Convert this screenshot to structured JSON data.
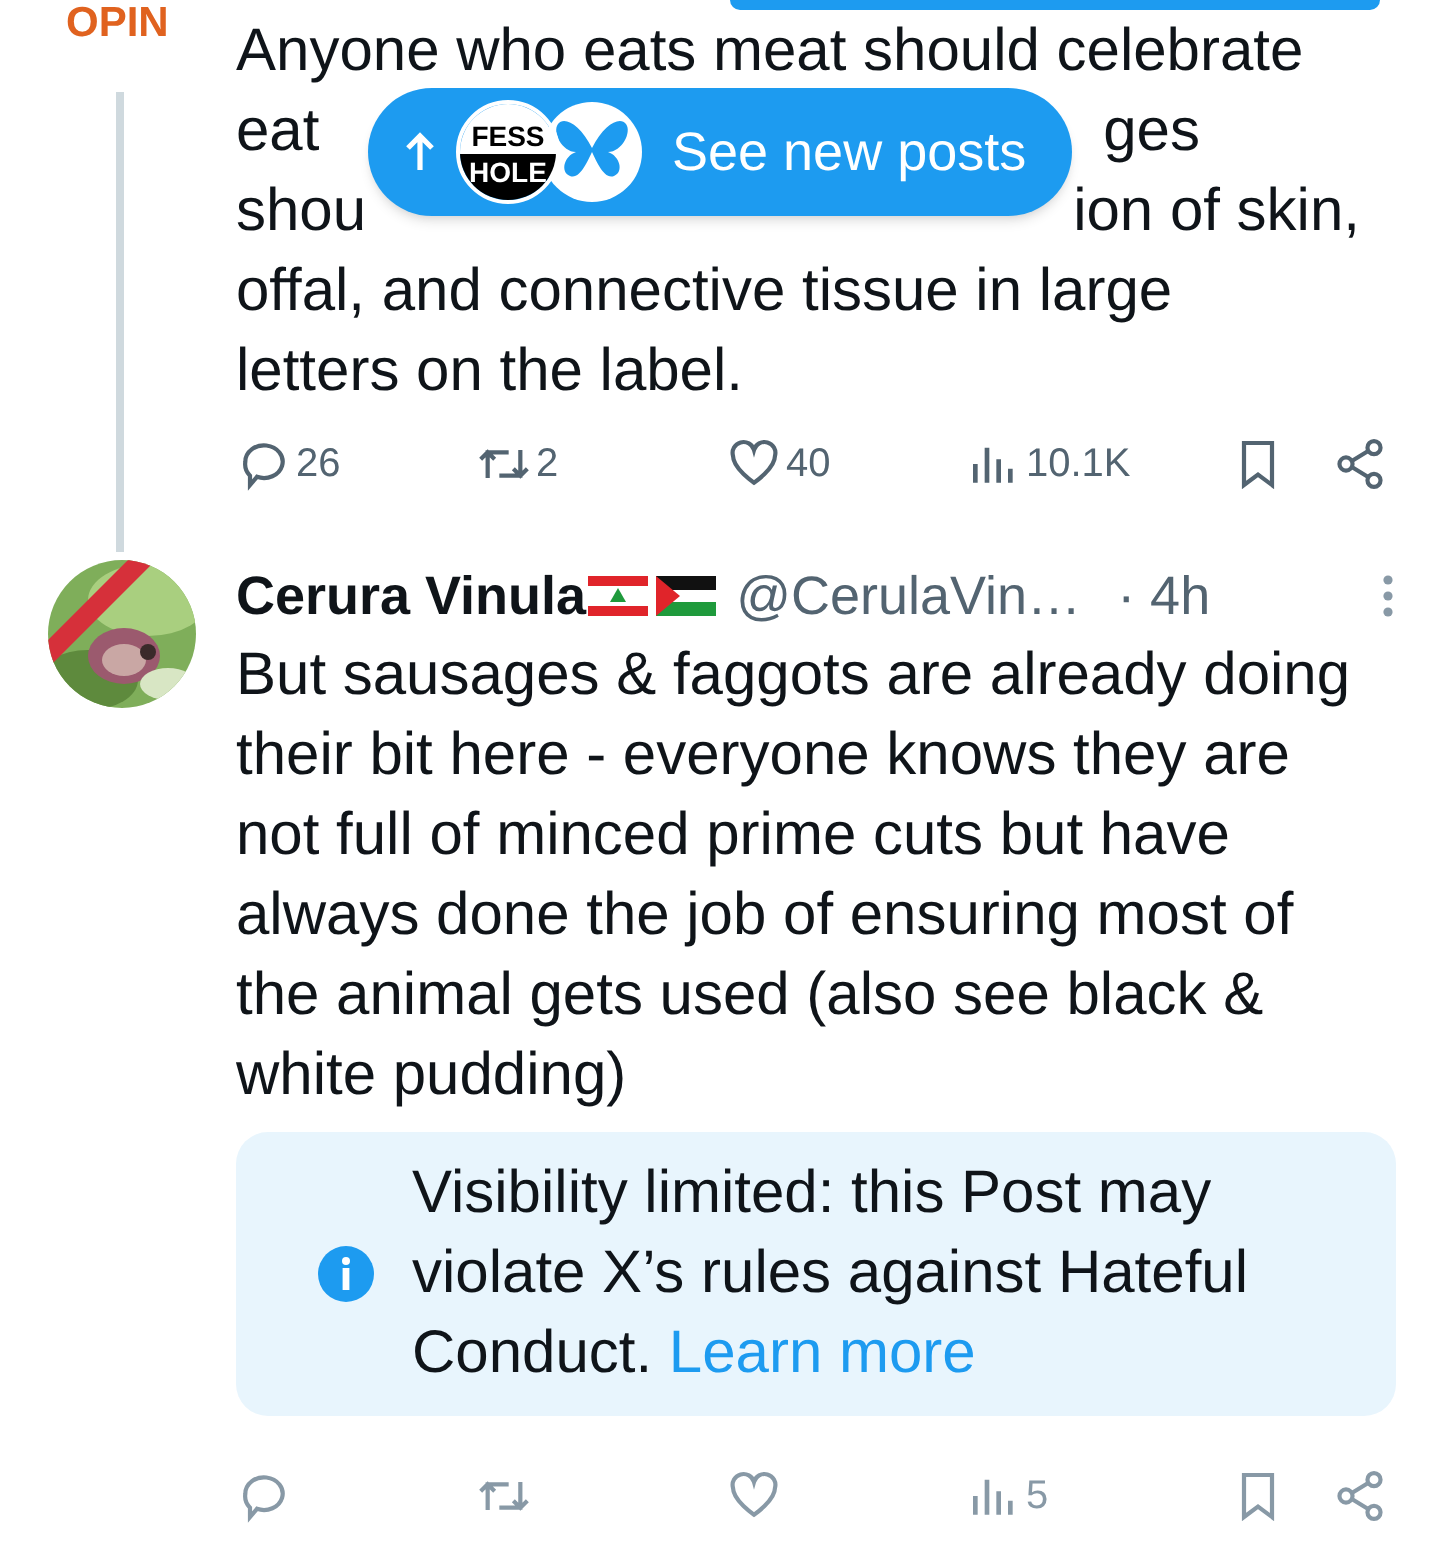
{
  "prev_post": {
    "label": "OPIN",
    "text_lines": [
      {
        "parts": [
          "Anyone who eats meat should celebrate"
        ]
      },
      {
        "parts": [
          "eat",
          "ges"
        ]
      },
      {
        "parts": [
          "shou",
          "ion of skin,"
        ]
      },
      {
        "parts": [
          "offal, and connective tissue in large"
        ]
      },
      {
        "parts": [
          "letters on the label."
        ]
      }
    ],
    "actions": [
      {
        "kind": "reply",
        "count": "26"
      },
      {
        "kind": "repost",
        "count": "2"
      },
      {
        "kind": "like",
        "count": "40"
      },
      {
        "kind": "views",
        "count": "10.1K"
      },
      {
        "kind": "bookmark"
      },
      {
        "kind": "share"
      }
    ]
  },
  "new_posts_pill": {
    "label": "See new posts",
    "avatar_text": [
      "FESS",
      "HOLE"
    ]
  },
  "post": {
    "name": "Cerura Vinula",
    "handle": "@CerulaVin…",
    "time": "· 4h",
    "text": "But sausages & faggots are already doing their bit here - everyone knows they are not full of minced prime cuts but have always done the job of ensuring most of the animal gets used (also see black & white pudding)",
    "notice": {
      "text": "Visibility limited: this Post may violate X’s rules against Hateful Conduct.",
      "link": "Learn more"
    },
    "actions": [
      {
        "kind": "reply"
      },
      {
        "kind": "repost"
      },
      {
        "kind": "like"
      },
      {
        "kind": "views",
        "count": "5"
      },
      {
        "kind": "bookmark"
      },
      {
        "kind": "share"
      }
    ]
  }
}
